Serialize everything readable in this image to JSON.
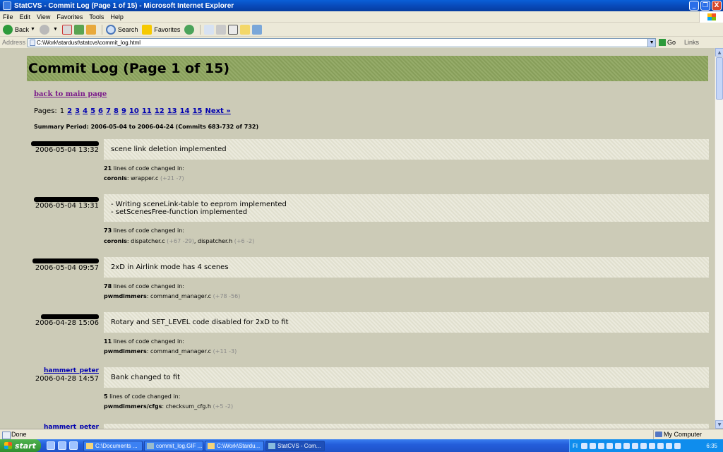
{
  "window": {
    "title": "StatCVS - Commit Log (Page 1 of 15) - Microsoft Internet Explorer",
    "minimize": "_",
    "maximize": "❐",
    "close": "X"
  },
  "menu": [
    "File",
    "Edit",
    "View",
    "Favorites",
    "Tools",
    "Help"
  ],
  "toolbar": {
    "back": "Back",
    "search": "Search",
    "favorites": "Favorites"
  },
  "address": {
    "label": "Address",
    "value": "C:\\Work\\stardust\\statcvs\\commit_log.html",
    "go": "Go",
    "links": "Links"
  },
  "page": {
    "title": "Commit Log (Page 1 of 15)",
    "back_link": "back to main page",
    "pages_label": "Pages:",
    "current_page": "1",
    "page_links": [
      "2",
      "3",
      "4",
      "5",
      "6",
      "7",
      "8",
      "9",
      "10",
      "11",
      "12",
      "13",
      "14",
      "15"
    ],
    "next": "Next »",
    "summary": "Summary Period: 2006-05-04 to 2006-04-24 (Commits 683-732 of 732)"
  },
  "commits": [
    {
      "author": "",
      "date": "2006-05-04 13:32",
      "message": [
        "scene link deletion implemented"
      ],
      "lines": "21",
      "changed_suffix": " lines of code changed in:",
      "module": "coronis",
      "files": [
        {
          "name": "wrapper.c",
          "delta": "(+21 -7)"
        }
      ]
    },
    {
      "author": "",
      "date": "2006-05-04 13:31",
      "message": [
        "- Writing sceneLink-table to eeprom implemented",
        "- setScenesFree-function implemented"
      ],
      "lines": "73",
      "changed_suffix": " lines of code changed in:",
      "module": "coronis",
      "files": [
        {
          "name": "dispatcher.c",
          "delta": "(+67 -29)"
        },
        {
          "name": "dispatcher.h",
          "delta": "(+6 -2)"
        }
      ]
    },
    {
      "author": "",
      "date": "2006-05-04 09:57",
      "message": [
        "2xD in Airlink mode has 4 scenes"
      ],
      "lines": "78",
      "changed_suffix": " lines of code changed in:",
      "module": "pwmdimmers",
      "files": [
        {
          "name": "command_manager.c",
          "delta": "(+78 -56)"
        }
      ]
    },
    {
      "author": "",
      "date": "2006-04-28 15:06",
      "message": [
        "Rotary and SET_LEVEL code disabled for 2xD to fit"
      ],
      "lines": "11",
      "changed_suffix": " lines of code changed in:",
      "module": "pwmdimmers",
      "files": [
        {
          "name": "command_manager.c",
          "delta": "(+11 -3)"
        }
      ]
    },
    {
      "author": "hammert_peter",
      "date": "2006-04-28 14:57",
      "message": [
        "Bank changed to fit"
      ],
      "lines": "5",
      "changed_suffix": " lines of code changed in:",
      "module": "pwmdimmers/cfgs",
      "files": [
        {
          "name": "checksum_cfg.h",
          "delta": "(+5 -2)"
        }
      ]
    },
    {
      "author": "hammert_peter"
    }
  ],
  "status": {
    "text": "Done",
    "zone": "My Computer"
  },
  "taskbar": {
    "start": "start",
    "tasks": [
      "C:\\Documents ...",
      "commit_log.GIF ...",
      "C:\\Work\\Stardu...",
      "StatCVS - Com..."
    ],
    "tray_label": "FI",
    "clock": "6:35"
  }
}
